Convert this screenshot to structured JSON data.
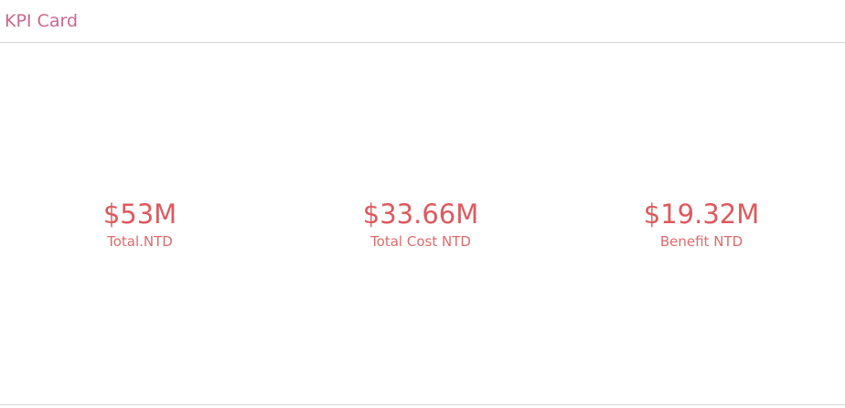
{
  "header": {
    "title": "KPI Card"
  },
  "kpis": [
    {
      "value": "$53M",
      "label": "Total.NTD"
    },
    {
      "value": "$33.66M",
      "label": "Total Cost NTD"
    },
    {
      "value": "$19.32M",
      "label": "Benefit NTD"
    }
  ],
  "colors": {
    "title": "#c9678c",
    "value": "#dc5a5e",
    "label": "#dc6b6e",
    "divider": "#d4d4d4"
  }
}
